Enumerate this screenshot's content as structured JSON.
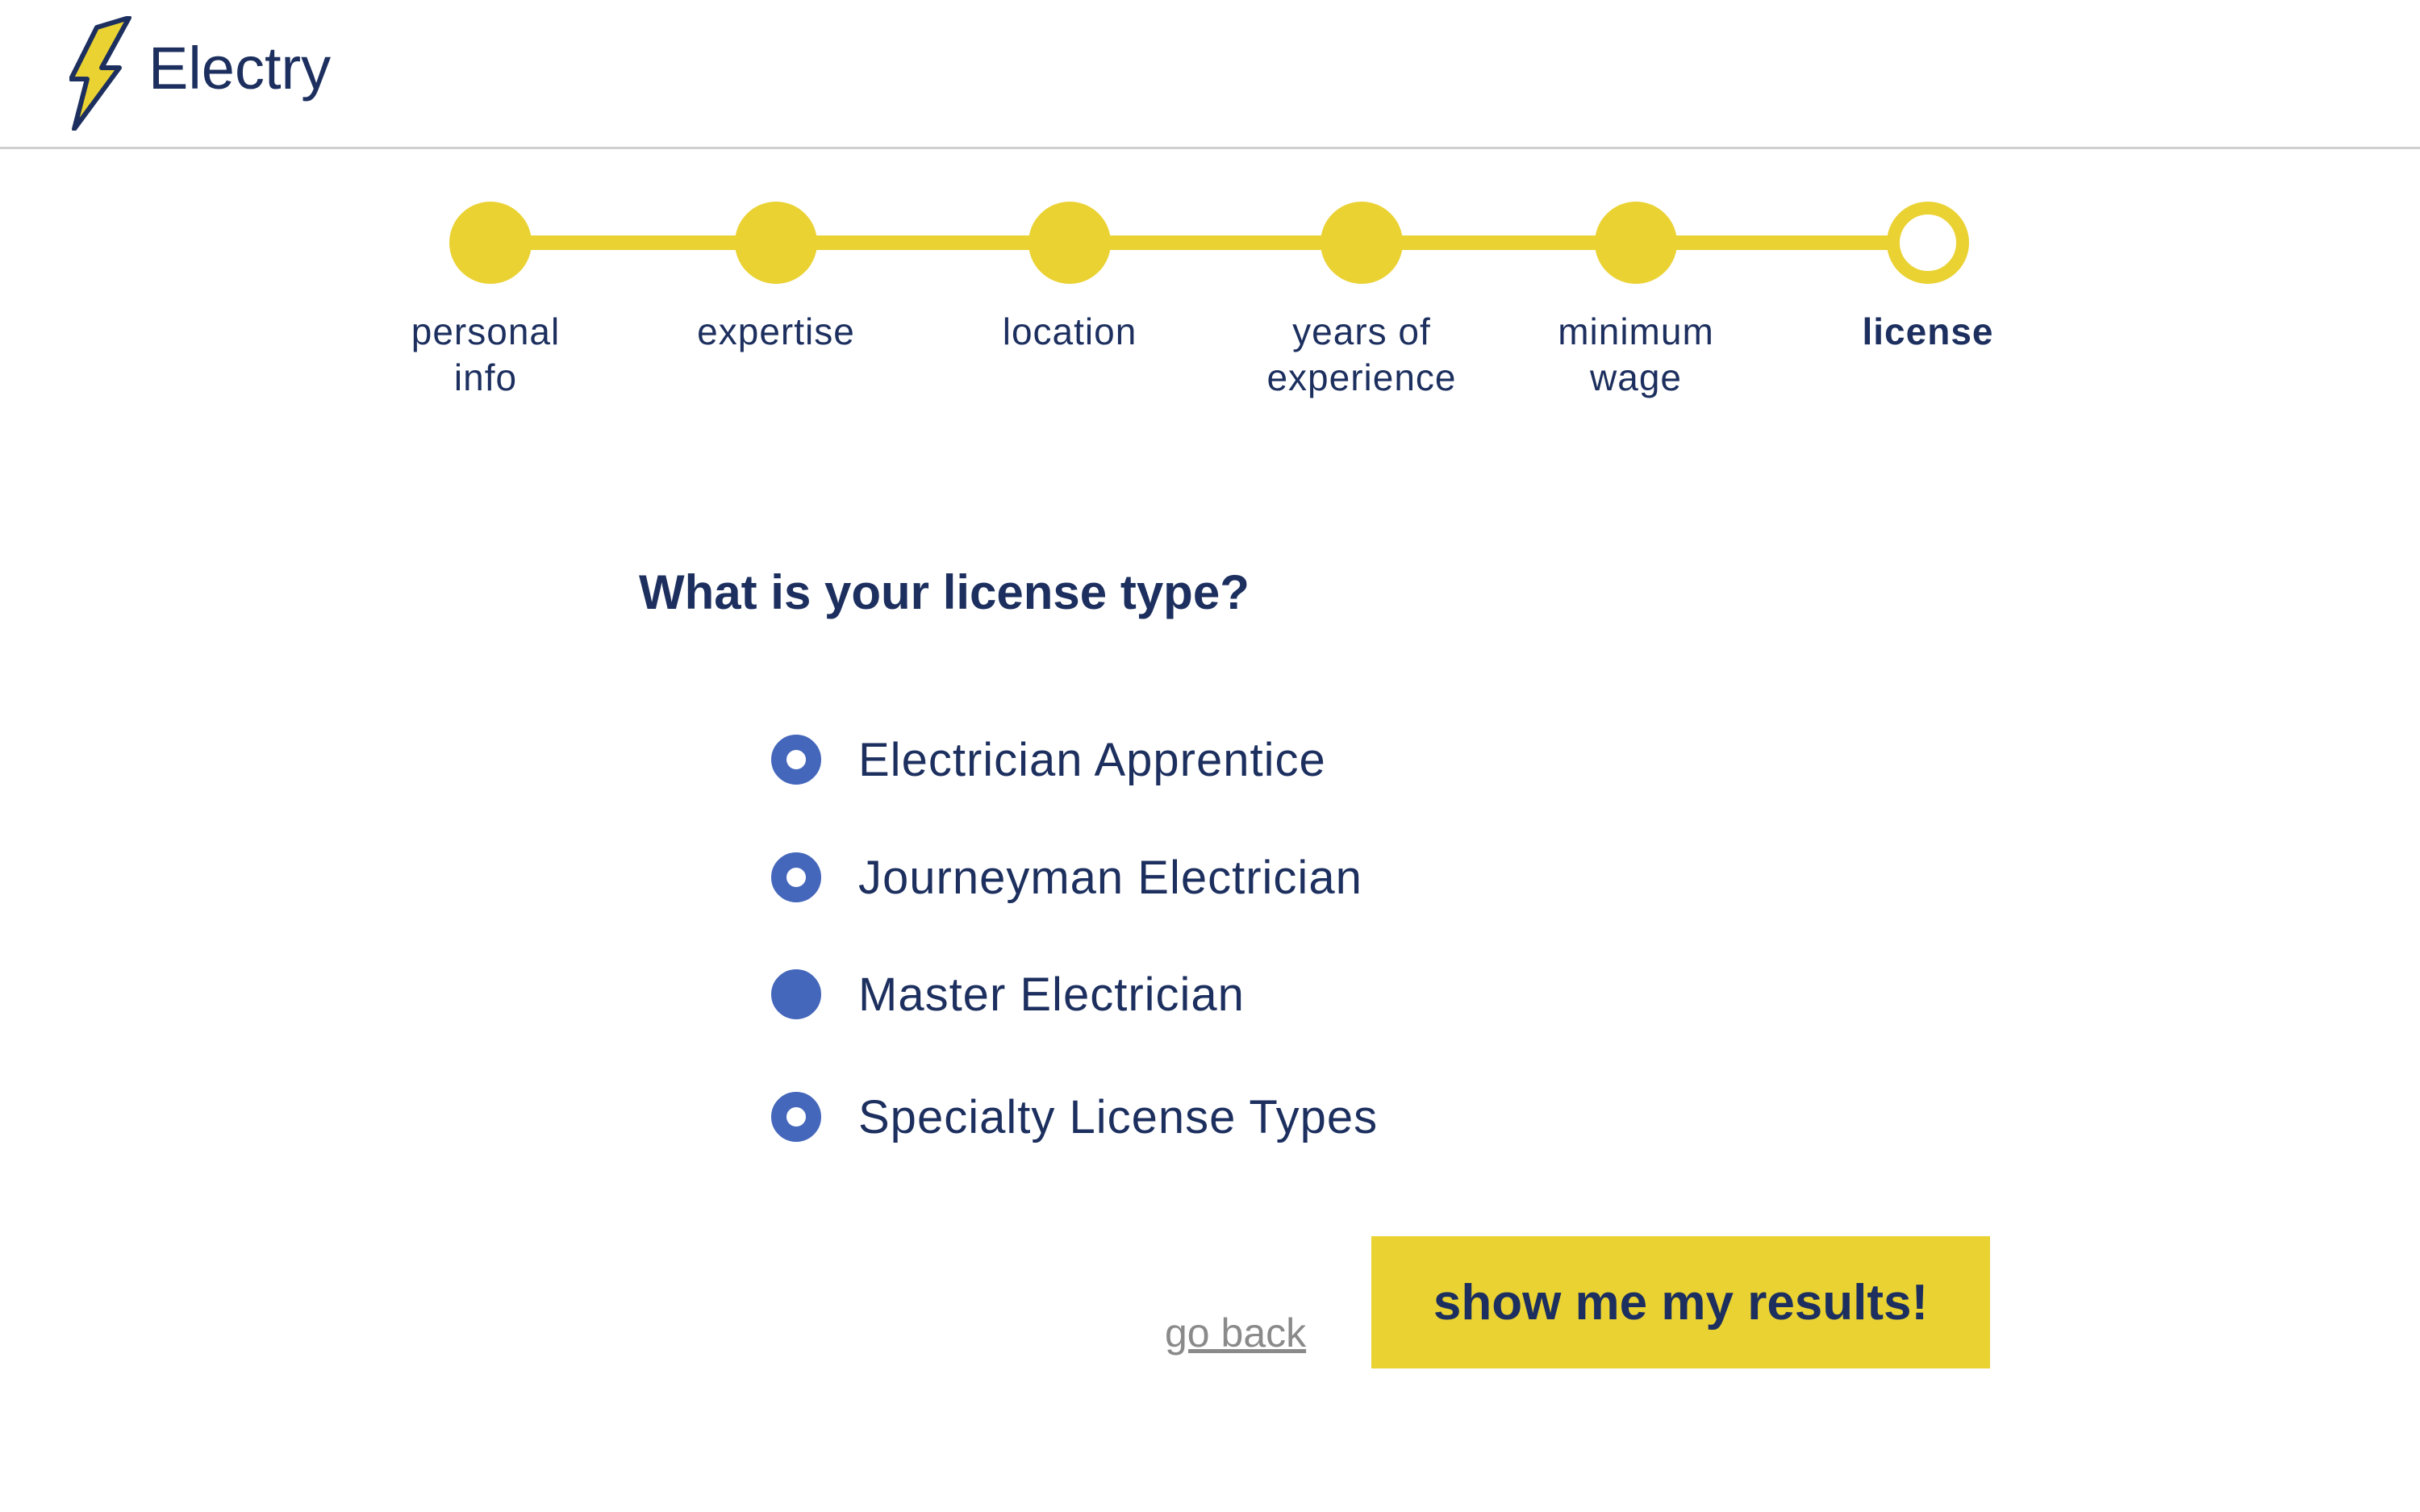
{
  "app": {
    "name": "Electry"
  },
  "stepper": {
    "steps": [
      {
        "label": "personal\ninfo",
        "state": "done"
      },
      {
        "label": "expertise",
        "state": "done"
      },
      {
        "label": "location",
        "state": "done"
      },
      {
        "label": "years of\nexperience",
        "state": "done"
      },
      {
        "label": "minimum\nwage",
        "state": "done"
      },
      {
        "label": "license",
        "state": "current"
      }
    ]
  },
  "form": {
    "question": "What is your license type?",
    "options": [
      {
        "label": "Electrician Apprentice",
        "checked": false
      },
      {
        "label": "Journeyman Electrician",
        "checked": false
      },
      {
        "label": "Master Electrician",
        "checked": true
      },
      {
        "label": "Specialty License Types",
        "checked": false
      }
    ]
  },
  "actions": {
    "go_back": "go back",
    "submit": "show me my results!"
  },
  "colors": {
    "accent_yellow": "#ead233",
    "text_navy": "#1c2f5e",
    "radio_blue": "#4467bb"
  }
}
